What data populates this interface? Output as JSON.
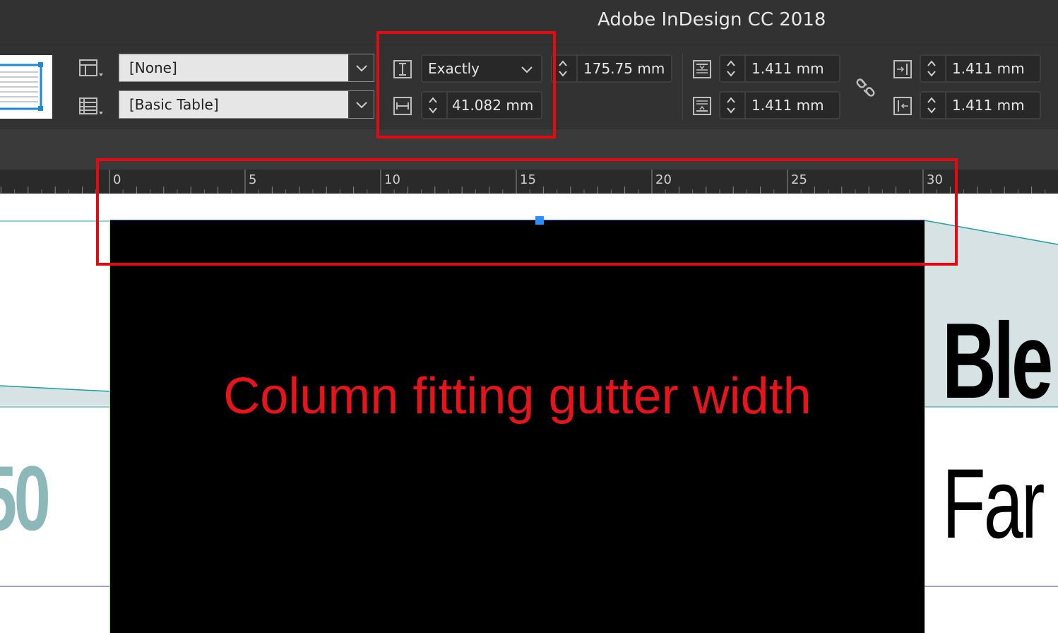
{
  "app": {
    "title": "Adobe InDesign CC 2018"
  },
  "control_panel": {
    "cell_style": "[None]",
    "table_style": "[Basic Table]",
    "row_height_mode": "Exactly",
    "row_height": "175.75 mm",
    "column_width": "41.082 mm",
    "inset_top": "1.411 mm",
    "inset_bottom": "1.411 mm",
    "inset_left": "1.411 mm",
    "inset_right": "1.411 mm"
  },
  "ruler": {
    "marks": [
      "0",
      "5",
      "10",
      "15",
      "20",
      "25",
      "30"
    ]
  },
  "document": {
    "caption": "Column fitting gutter width",
    "left_number": "50",
    "right_text_1": "Ble",
    "right_text_2": "Far"
  },
  "colors": {
    "accent_red": "#e50914",
    "teal": "#1aa0a0",
    "panel_bg": "#323232",
    "selection_blue": "#2a90ff",
    "number_teal": "#8cb8ba"
  }
}
